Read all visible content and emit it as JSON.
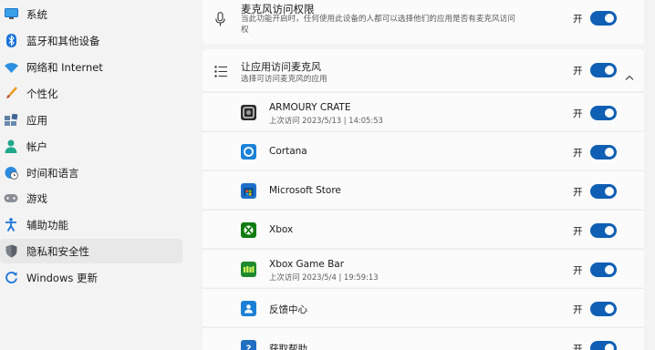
{
  "sidebar": {
    "items": [
      {
        "label": "系统",
        "icon": "monitor-icon"
      },
      {
        "label": "蓝牙和其他设备",
        "icon": "bluetooth-icon"
      },
      {
        "label": "网络和 Internet",
        "icon": "wifi-icon"
      },
      {
        "label": "个性化",
        "icon": "brush-icon"
      },
      {
        "label": "应用",
        "icon": "apps-icon"
      },
      {
        "label": "帐户",
        "icon": "person-icon"
      },
      {
        "label": "时间和语言",
        "icon": "globe-clock-icon"
      },
      {
        "label": "游戏",
        "icon": "gamepad-icon"
      },
      {
        "label": "辅助功能",
        "icon": "accessibility-icon"
      },
      {
        "label": "隐私和安全性",
        "icon": "shield-icon",
        "selected": true
      },
      {
        "label": "Windows 更新",
        "icon": "windows-update-icon"
      }
    ]
  },
  "top_setting": {
    "title": "麦克风访问权限",
    "description_line1": "当此功能开启时，任何使用此设备的人都可以选择他们的应用是否有麦克风访问",
    "description_line2": "权",
    "state": "开"
  },
  "app_access": {
    "title": "让应用访问麦克风",
    "subtitle": "选择可访问麦克风的应用",
    "state": "开"
  },
  "apps": [
    {
      "name": "ARMOURY CRATE",
      "last_access": "上次访问 2023/5/13 | 14:05:53",
      "state": "开",
      "icon": "armoury-crate-icon"
    },
    {
      "name": "Cortana",
      "last_access": "",
      "state": "开",
      "icon": "cortana-icon"
    },
    {
      "name": "Microsoft Store",
      "last_access": "",
      "state": "开",
      "icon": "microsoft-store-icon"
    },
    {
      "name": "Xbox",
      "last_access": "",
      "state": "开",
      "icon": "xbox-icon"
    },
    {
      "name": "Xbox Game Bar",
      "last_access": "上次访问 2023/5/4 | 19:59:13",
      "state": "开",
      "icon": "xbox-game-bar-icon"
    },
    {
      "name": "反馈中心",
      "last_access": "",
      "state": "开",
      "icon": "feedback-hub-icon"
    },
    {
      "name": "获取帮助",
      "last_access": "",
      "state": "开",
      "icon": "get-help-icon"
    }
  ],
  "colors": {
    "accent": "#0f5fb4",
    "selected_nav": "#e8e8e8",
    "background": "#f3f3f3"
  }
}
